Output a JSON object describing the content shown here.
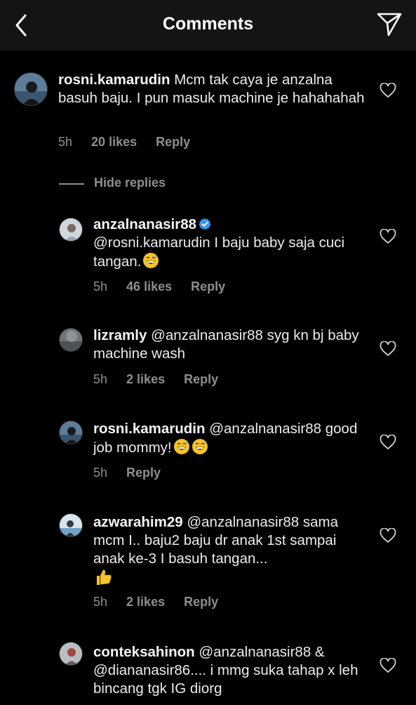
{
  "header": {
    "title": "Comments",
    "back_icon": "chevron-left-icon",
    "send_icon": "paper-plane-icon"
  },
  "main_comment": {
    "username": "rosni.kamarudin",
    "text": "Mcm tak caya je anzalna basuh baju. I pun masuk machine je hahahahah",
    "time": "5h",
    "likes": "20 likes",
    "reply": "Reply"
  },
  "hide_replies": "Hide replies",
  "replies": [
    {
      "username": "anzalnanasir88",
      "verified": true,
      "text": "@rosni.kamarudin I baju baby saja cuci tangan.",
      "emoji": "😅",
      "time": "5h",
      "likes": "46 likes",
      "reply": "Reply"
    },
    {
      "username": "lizramly",
      "text": "@anzalnanasir88 syg kn bj baby machine wash",
      "time": "5h",
      "likes": "2 likes",
      "reply": "Reply"
    },
    {
      "username": "rosni.kamarudin",
      "text": "@anzalnanasir88 good job mommy!",
      "emoji": "😅😅",
      "time": "5h",
      "likes": "",
      "reply": "Reply"
    },
    {
      "username": "azwarahim29",
      "text": "@anzalnanasir88 sama mcm I.. baju2 baju dr anak 1st sampai anak ke-3 I basuh tangan...",
      "emoji": "👍",
      "time": "5h",
      "likes": "2 likes",
      "reply": "Reply"
    },
    {
      "username": "conteksahinon",
      "text": "@anzalnanasir88 & @diananasir86.... i mmg  suka tahap x leh bincang tgk  IG diorg",
      "time": "",
      "likes": "",
      "reply": ""
    }
  ],
  "colors": {
    "background": "#000000",
    "header": "#141414",
    "text": "#ececec",
    "meta": "#8e8e8e",
    "verified": "#3897f0"
  }
}
